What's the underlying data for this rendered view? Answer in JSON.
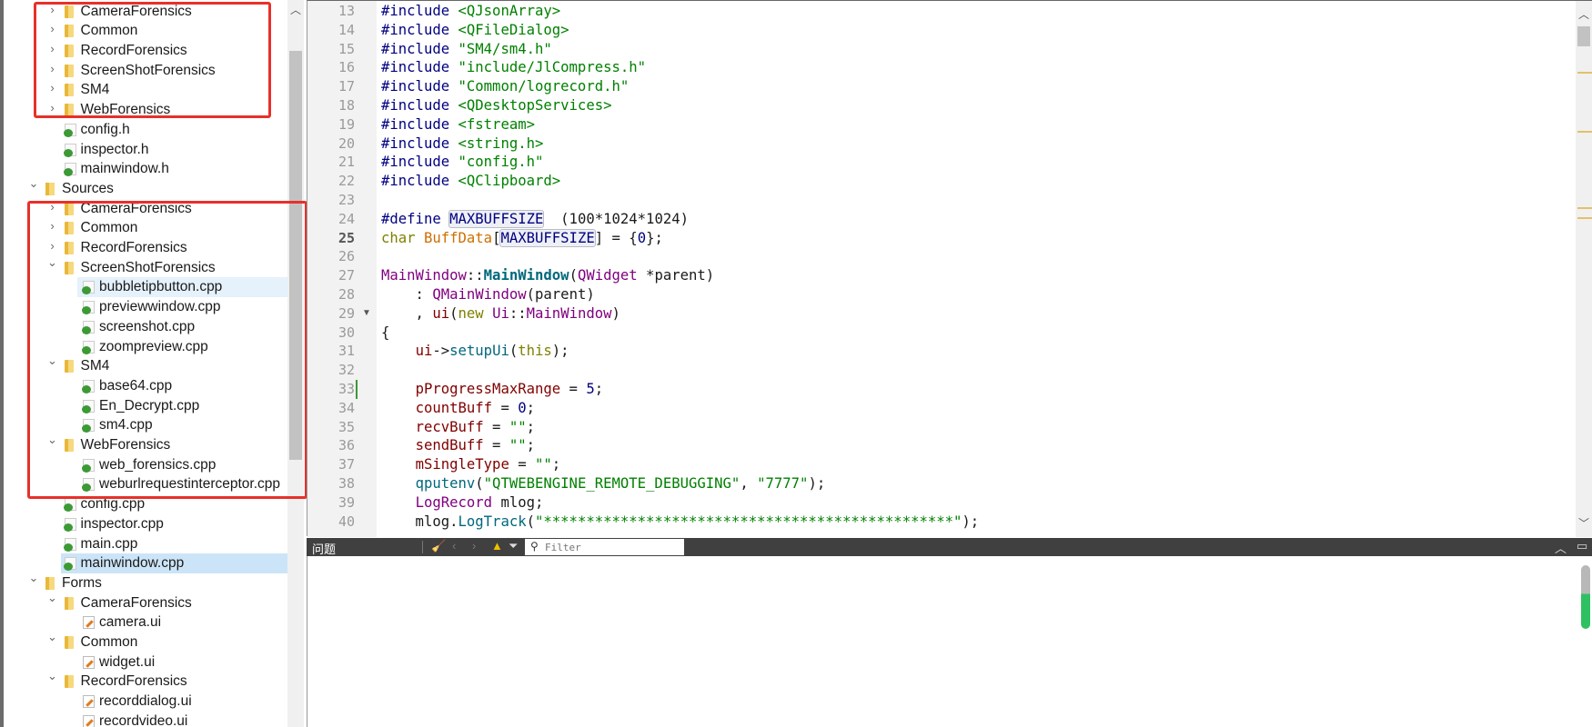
{
  "tree": {
    "rows": [
      {
        "label": "CameraForensics",
        "level": 1,
        "type": "folder",
        "chevron": "right"
      },
      {
        "label": "Common",
        "level": 1,
        "type": "folder",
        "chevron": "right"
      },
      {
        "label": "RecordForensics",
        "level": 1,
        "type": "folder",
        "chevron": "right"
      },
      {
        "label": "ScreenShotForensics",
        "level": 1,
        "type": "folder",
        "chevron": "right"
      },
      {
        "label": "SM4",
        "level": 1,
        "type": "folder",
        "chevron": "right"
      },
      {
        "label": "WebForensics",
        "level": 1,
        "type": "folder",
        "chevron": "right"
      },
      {
        "label": "config.h",
        "level": 1,
        "type": "file"
      },
      {
        "label": "inspector.h",
        "level": 1,
        "type": "file"
      },
      {
        "label": "mainwindow.h",
        "level": 1,
        "type": "file"
      },
      {
        "label": "Sources",
        "level": 0,
        "type": "src",
        "chevron": "down"
      },
      {
        "label": "CameraForensics",
        "level": 1,
        "type": "folder",
        "chevron": "right"
      },
      {
        "label": "Common",
        "level": 1,
        "type": "folder",
        "chevron": "right"
      },
      {
        "label": "RecordForensics",
        "level": 1,
        "type": "folder",
        "chevron": "right"
      },
      {
        "label": "ScreenShotForensics",
        "level": 1,
        "type": "folder",
        "chevron": "down"
      },
      {
        "label": "bubbletipbutton.cpp",
        "level": 2,
        "type": "file",
        "state": "hover"
      },
      {
        "label": "previewwindow.cpp",
        "level": 2,
        "type": "file"
      },
      {
        "label": "screenshot.cpp",
        "level": 2,
        "type": "file"
      },
      {
        "label": "zoompreview.cpp",
        "level": 2,
        "type": "file"
      },
      {
        "label": "SM4",
        "level": 1,
        "type": "folder",
        "chevron": "down"
      },
      {
        "label": "base64.cpp",
        "level": 2,
        "type": "file"
      },
      {
        "label": "En_Decrypt.cpp",
        "level": 2,
        "type": "file"
      },
      {
        "label": "sm4.cpp",
        "level": 2,
        "type": "file"
      },
      {
        "label": "WebForensics",
        "level": 1,
        "type": "folder",
        "chevron": "down"
      },
      {
        "label": "web_forensics.cpp",
        "level": 2,
        "type": "file"
      },
      {
        "label": "weburlrequestinterceptor.cpp",
        "level": 2,
        "type": "file"
      },
      {
        "label": "config.cpp",
        "level": 1,
        "type": "file"
      },
      {
        "label": "inspector.cpp",
        "level": 1,
        "type": "file"
      },
      {
        "label": "main.cpp",
        "level": 1,
        "type": "file"
      },
      {
        "label": "mainwindow.cpp",
        "level": 1,
        "type": "file",
        "state": "selected"
      },
      {
        "label": "Forms",
        "level": 0,
        "type": "forms",
        "chevron": "down"
      },
      {
        "label": "CameraForensics",
        "level": 1,
        "type": "folder",
        "chevron": "down"
      },
      {
        "label": "camera.ui",
        "level": 2,
        "type": "ui"
      },
      {
        "label": "Common",
        "level": 1,
        "type": "folder",
        "chevron": "down"
      },
      {
        "label": "widget.ui",
        "level": 2,
        "type": "ui"
      },
      {
        "label": "RecordForensics",
        "level": 1,
        "type": "folder",
        "chevron": "down"
      },
      {
        "label": "recorddialog.ui",
        "level": 2,
        "type": "ui"
      },
      {
        "label": "recordvideo.ui",
        "level": 2,
        "type": "ui"
      }
    ]
  },
  "highlight_color": "#e8302a",
  "editor": {
    "current_line": 25,
    "changed_line": 33,
    "fold_line": 29,
    "lines": [
      {
        "n": "13",
        "t": [
          [
            "pp",
            "#include "
          ],
          [
            "str",
            "<QJsonArray>"
          ]
        ]
      },
      {
        "n": "14",
        "t": [
          [
            "pp",
            "#include "
          ],
          [
            "str",
            "<QFileDialog>"
          ]
        ]
      },
      {
        "n": "15",
        "t": [
          [
            "pp",
            "#include "
          ],
          [
            "str",
            "\"SM4/sm4.h\""
          ]
        ]
      },
      {
        "n": "16",
        "t": [
          [
            "pp",
            "#include "
          ],
          [
            "str",
            "\"include/JlCompress.h\""
          ]
        ]
      },
      {
        "n": "17",
        "t": [
          [
            "pp",
            "#include "
          ],
          [
            "str",
            "\"Common/logrecord.h\""
          ]
        ]
      },
      {
        "n": "18",
        "t": [
          [
            "pp",
            "#include "
          ],
          [
            "str",
            "<QDesktopServices>"
          ]
        ]
      },
      {
        "n": "19",
        "t": [
          [
            "pp",
            "#include "
          ],
          [
            "str",
            "<fstream>"
          ]
        ]
      },
      {
        "n": "20",
        "t": [
          [
            "pp",
            "#include "
          ],
          [
            "str",
            "<string.h>"
          ]
        ]
      },
      {
        "n": "21",
        "t": [
          [
            "pp",
            "#include "
          ],
          [
            "str",
            "\"config.h\""
          ]
        ]
      },
      {
        "n": "22",
        "t": [
          [
            "pp",
            "#include "
          ],
          [
            "str",
            "<QClipboard>"
          ]
        ]
      },
      {
        "n": "23",
        "t": []
      },
      {
        "n": "24",
        "t": [
          [
            "pp",
            "#define "
          ],
          [
            "mac",
            "MAXBUFFSIZE"
          ],
          [
            "",
            "  (100*1024*1024)"
          ]
        ]
      },
      {
        "n": "25",
        "t": [
          [
            "kw",
            "char "
          ],
          [
            "glob",
            "BuffData"
          ],
          [
            "",
            "["
          ],
          [
            "mac",
            "MAXBUFFSIZE"
          ],
          [
            "",
            "] = {"
          ],
          [
            "num",
            "0"
          ],
          [
            "",
            "};"
          ]
        ]
      },
      {
        "n": "26",
        "t": []
      },
      {
        "n": "27",
        "t": [
          [
            "type",
            "MainWindow"
          ],
          [
            "",
            "::"
          ],
          [
            "fnb",
            "MainWindow"
          ],
          [
            "",
            "("
          ],
          [
            "type",
            "QWidget"
          ],
          [
            "",
            " *parent)"
          ]
        ]
      },
      {
        "n": "28",
        "t": [
          [
            "",
            "    : "
          ],
          [
            "type",
            "QMainWindow"
          ],
          [
            "",
            "(parent)"
          ]
        ]
      },
      {
        "n": "29",
        "t": [
          [
            "",
            "    , "
          ],
          [
            "mem",
            "ui"
          ],
          [
            "",
            "("
          ],
          [
            "kw",
            "new "
          ],
          [
            "type",
            "Ui"
          ],
          [
            "",
            "::"
          ],
          [
            "type",
            "MainWindow"
          ],
          [
            "",
            ")"
          ]
        ]
      },
      {
        "n": "30",
        "t": [
          [
            "",
            "{"
          ]
        ]
      },
      {
        "n": "31",
        "t": [
          [
            "",
            "    "
          ],
          [
            "mem",
            "ui"
          ],
          [
            "",
            "->"
          ],
          [
            "fn",
            "setupUi"
          ],
          [
            "",
            "("
          ],
          [
            "kw",
            "this"
          ],
          [
            "",
            ");"
          ]
        ]
      },
      {
        "n": "32",
        "t": []
      },
      {
        "n": "33",
        "t": [
          [
            "",
            "    "
          ],
          [
            "mem",
            "pProgressMaxRange"
          ],
          [
            "",
            " = "
          ],
          [
            "num",
            "5"
          ],
          [
            "",
            ";"
          ]
        ]
      },
      {
        "n": "34",
        "t": [
          [
            "",
            "    "
          ],
          [
            "mem",
            "countBuff"
          ],
          [
            "",
            " = "
          ],
          [
            "num",
            "0"
          ],
          [
            "",
            ";"
          ]
        ]
      },
      {
        "n": "35",
        "t": [
          [
            "",
            "    "
          ],
          [
            "mem",
            "recvBuff"
          ],
          [
            "",
            " = "
          ],
          [
            "str",
            "\"\""
          ],
          [
            "",
            ";"
          ]
        ]
      },
      {
        "n": "36",
        "t": [
          [
            "",
            "    "
          ],
          [
            "mem",
            "sendBuff"
          ],
          [
            "",
            " = "
          ],
          [
            "str",
            "\"\""
          ],
          [
            "",
            ";"
          ]
        ]
      },
      {
        "n": "37",
        "t": [
          [
            "",
            "    "
          ],
          [
            "mem",
            "mSingleType"
          ],
          [
            "",
            " = "
          ],
          [
            "str",
            "\"\""
          ],
          [
            "",
            ";"
          ]
        ]
      },
      {
        "n": "38",
        "t": [
          [
            "",
            "    "
          ],
          [
            "fn",
            "qputenv"
          ],
          [
            "",
            "("
          ],
          [
            "str",
            "\"QTWEBENGINE_REMOTE_DEBUGGING\""
          ],
          [
            "",
            ", "
          ],
          [
            "str",
            "\"7777\""
          ],
          [
            "",
            ");"
          ]
        ]
      },
      {
        "n": "39",
        "t": [
          [
            "",
            "    "
          ],
          [
            "type",
            "LogRecord"
          ],
          [
            "",
            " mlog;"
          ]
        ]
      },
      {
        "n": "40",
        "t": [
          [
            "",
            "    mlog."
          ],
          [
            "fn",
            "LogTrack"
          ],
          [
            "",
            "("
          ],
          [
            "str",
            "\"************************************************\""
          ],
          [
            "",
            ");"
          ]
        ]
      }
    ]
  },
  "issues": {
    "title": "问题",
    "filter_placeholder": "Filter",
    "icons": [
      "clear-icon",
      "prev-icon",
      "next-icon",
      "warning-icon",
      "filter-icon",
      "search-icon",
      "collapse-icon",
      "float-icon"
    ]
  }
}
